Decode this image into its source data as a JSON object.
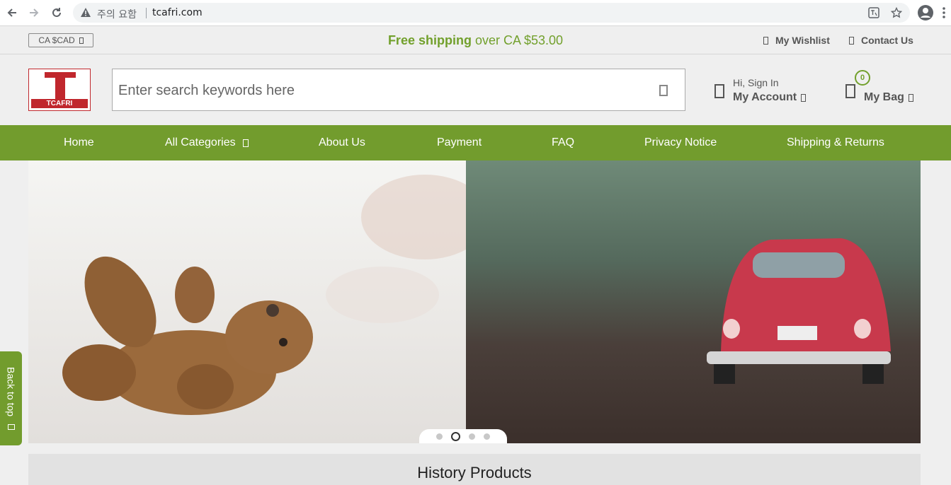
{
  "browser": {
    "security_label": "주의 요함",
    "url": "tcafri.com"
  },
  "topbar": {
    "currency": "CA $CAD",
    "shipping_bold": "Free shipping",
    "shipping_rest": "over CA $53.00",
    "wishlist": "My Wishlist",
    "contact": "Contact Us"
  },
  "header": {
    "logo_text": "TCAFRI",
    "search_placeholder": "Enter search keywords here",
    "account_greeting": "Hi, Sign In",
    "account_label": "My Account",
    "bag_count": "0",
    "bag_label": "My Bag"
  },
  "nav": {
    "items": [
      {
        "label": "Home"
      },
      {
        "label": "All Categories"
      },
      {
        "label": "About Us"
      },
      {
        "label": "Payment"
      },
      {
        "label": "FAQ"
      },
      {
        "label": "Privacy Notice"
      },
      {
        "label": "Shipping & Returns"
      }
    ]
  },
  "carousel": {
    "slides": 4,
    "active_slide": 2
  },
  "back_to_top": "Back to top",
  "history": {
    "title": "History Products"
  },
  "colors": {
    "brand_green": "#729c2d",
    "logo_red": "#c0272d"
  },
  "icons": [
    "back-arrow-icon",
    "forward-arrow-icon",
    "reload-icon",
    "warning-icon",
    "translate-icon",
    "star-icon",
    "profile-icon",
    "menu-dots-icon",
    "heart-icon",
    "mail-icon",
    "search-icon",
    "user-icon",
    "bag-icon",
    "chevron-down-icon",
    "arrow-up-icon"
  ]
}
